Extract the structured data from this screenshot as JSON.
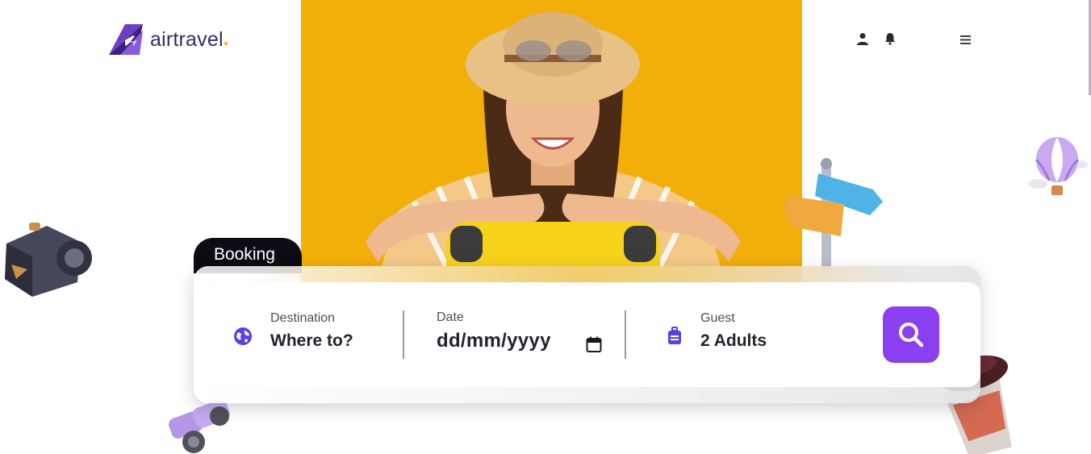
{
  "brand": {
    "name": "airtravel",
    "accent": "#f5b300",
    "primary": "#3a2a66"
  },
  "header": {
    "icons": [
      "user-icon",
      "bell-icon",
      "hamburger-menu-icon"
    ]
  },
  "hero": {
    "background": "#f2ae09"
  },
  "booking": {
    "tab_label": "Booking",
    "destination": {
      "label": "Destination",
      "value": "Where to?",
      "icon": "globe-icon"
    },
    "date": {
      "label": "Date",
      "value": "dd/mm/yyyy",
      "icon": "calendar-icon"
    },
    "guest": {
      "label": "Guest",
      "value": "2 Adults",
      "icon": "luggage-icon"
    },
    "search_icon": "search-icon",
    "search_color": "#8a3ff0"
  },
  "decorations": [
    "camera-icon",
    "binoculars-icon",
    "signpost-icon",
    "hot-air-balloon-icon",
    "coffee-cup-icon"
  ]
}
